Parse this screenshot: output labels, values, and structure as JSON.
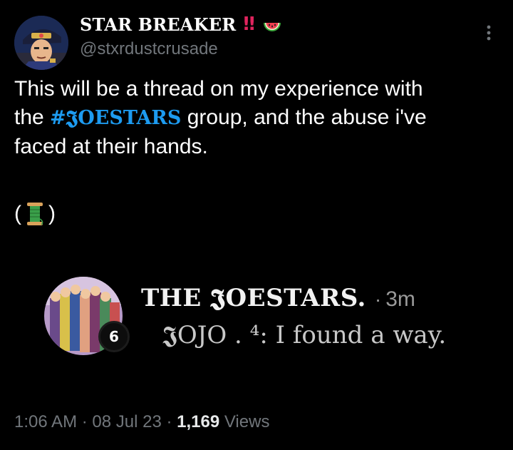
{
  "author": {
    "display_name": "STAR BREAKER",
    "bang_emoji": "‼",
    "trailing_emoji_icon": "watermelon-icon",
    "handle": "@stxrdustcrusade"
  },
  "tweet": {
    "line1": "This will be a thread on my experience with",
    "line2_prefix": "the ",
    "hashtag": "#𝕵OESTARS",
    "line2_suffix": " group, and the abuse i've",
    "line3": "faced at their hands.",
    "thread_open": "(",
    "thread_icon": "thread-spool-icon",
    "thread_close": ")"
  },
  "embedded_screenshot": {
    "group_name": "THE 𝕵OESTARS.",
    "separator": "·",
    "time_ago": "3m",
    "member_count": "6",
    "preview_sender": "𝕵OJO . ⁴",
    "preview_text": ": I found a way."
  },
  "meta": {
    "time": "1:06 AM",
    "sep1": " · ",
    "date": "08 Jul 23",
    "sep2": " · ",
    "views_count": "1,169",
    "views_label": " Views"
  },
  "colors": {
    "background": "#000000",
    "text": "#ffffff",
    "secondary_text": "#71767b",
    "link": "#1d9bf0"
  }
}
